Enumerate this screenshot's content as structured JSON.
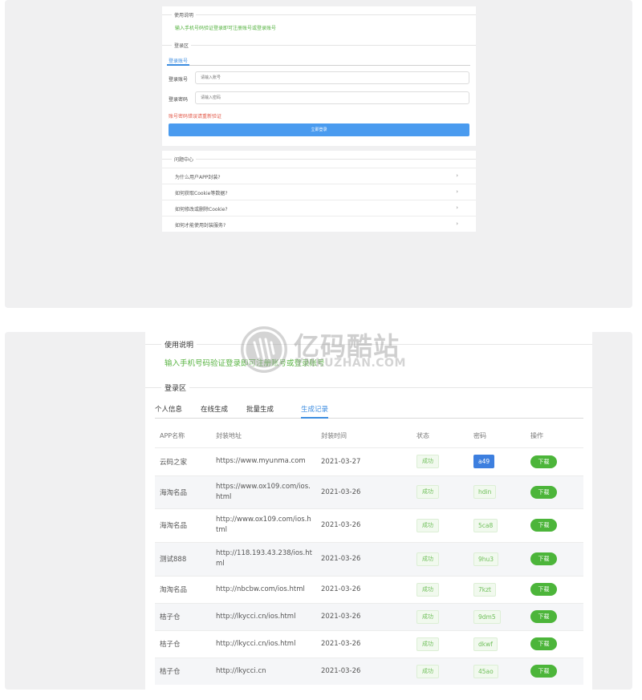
{
  "top": {
    "usage_title": "使用说明",
    "usage_text": "输入手机号码验证登录即可注册账号或登录账号",
    "login_title": "登录区",
    "tab_label": "登录账号",
    "account_label": "登录账号",
    "account_placeholder": "请输入账号",
    "password_label": "登录密码",
    "password_placeholder": "请输入密码",
    "warning": "账号密码错误请重新验证",
    "login_button": "立即登录",
    "faq_title": "问题中心",
    "faq_items": [
      "为什么用户APP封装?",
      "如何获取Cookie等数据?",
      "如何修改或删除Cookie?",
      "如何才能使用封装服务?"
    ]
  },
  "main": {
    "usage_title": "使用说明",
    "usage_text": "输入手机号码验证登录即可注册账号或登录账号",
    "login_title": "登录区",
    "tabs": [
      "个人信息",
      "在线生成",
      "批量生成",
      "生成记录"
    ],
    "active_tab": 3,
    "columns": [
      "APP名称",
      "封装地址",
      "封装时间",
      "状态",
      "密码",
      "操作"
    ],
    "rows": [
      {
        "name": "云码之家",
        "url": "https://www.myunma.com",
        "time": "2021-03-27",
        "status": "成功",
        "code": "a49",
        "action": "下载"
      },
      {
        "name": "海淘名品",
        "url": "https://www.ox109.com/ios.html",
        "time": "2021-03-26",
        "status": "成功",
        "code": "hdin",
        "action": "下载"
      },
      {
        "name": "海淘名品",
        "url": "http://www.ox109.com/ios.html",
        "time": "2021-03-26",
        "status": "成功",
        "code": "5ca8",
        "action": "下载"
      },
      {
        "name": "测试888",
        "url": "http://118.193.43.238/ios.html",
        "time": "2021-03-26",
        "status": "成功",
        "code": "9hu3",
        "action": "下载"
      },
      {
        "name": "淘淘名品",
        "url": "http://nbcbw.com/ios.html",
        "time": "2021-03-26",
        "status": "成功",
        "code": "7kzt",
        "action": "下载"
      },
      {
        "name": "桔子仓",
        "url": "http://lkycci.cn/ios.html",
        "time": "2021-03-26",
        "status": "成功",
        "code": "9dm5",
        "action": "下载"
      },
      {
        "name": "桔子仓",
        "url": "http://lkycci.cn/ios.html",
        "time": "2021-03-26",
        "status": "成功",
        "code": "dkwf",
        "action": "下载"
      },
      {
        "name": "桔子仓",
        "url": "http://lkycci.cn",
        "time": "2021-03-26",
        "status": "成功",
        "code": "45ao",
        "action": "下载"
      }
    ]
  },
  "watermark": {
    "title": "亿码酷站",
    "subtitle": "YMKUZHAN.COM"
  },
  "colors": {
    "accent_blue": "#3d8de0",
    "success_green": "#4cb53a",
    "text_green": "#57b340",
    "warning_red": "#e35a4a"
  }
}
